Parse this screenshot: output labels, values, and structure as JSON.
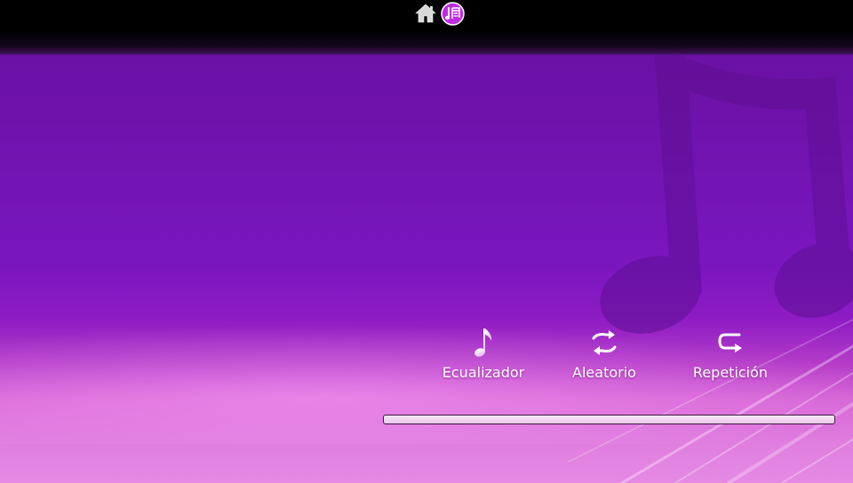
{
  "topbar": {
    "icons": [
      {
        "name": "home-icon"
      },
      {
        "name": "music-app-icon"
      }
    ]
  },
  "player": {
    "options": {
      "equalizer": {
        "label": "Ecualizador",
        "icon": "music-note-icon"
      },
      "shuffle": {
        "label": "Aleatorio",
        "icon": "shuffle-icon"
      },
      "repeat": {
        "label": "Repetición",
        "icon": "repeat-icon"
      }
    },
    "progress": 0
  },
  "colors": {
    "background_top": "#68109f",
    "background_bottom": "#e58ae4",
    "label_text": "#ffffff",
    "topbar": "#000000"
  }
}
